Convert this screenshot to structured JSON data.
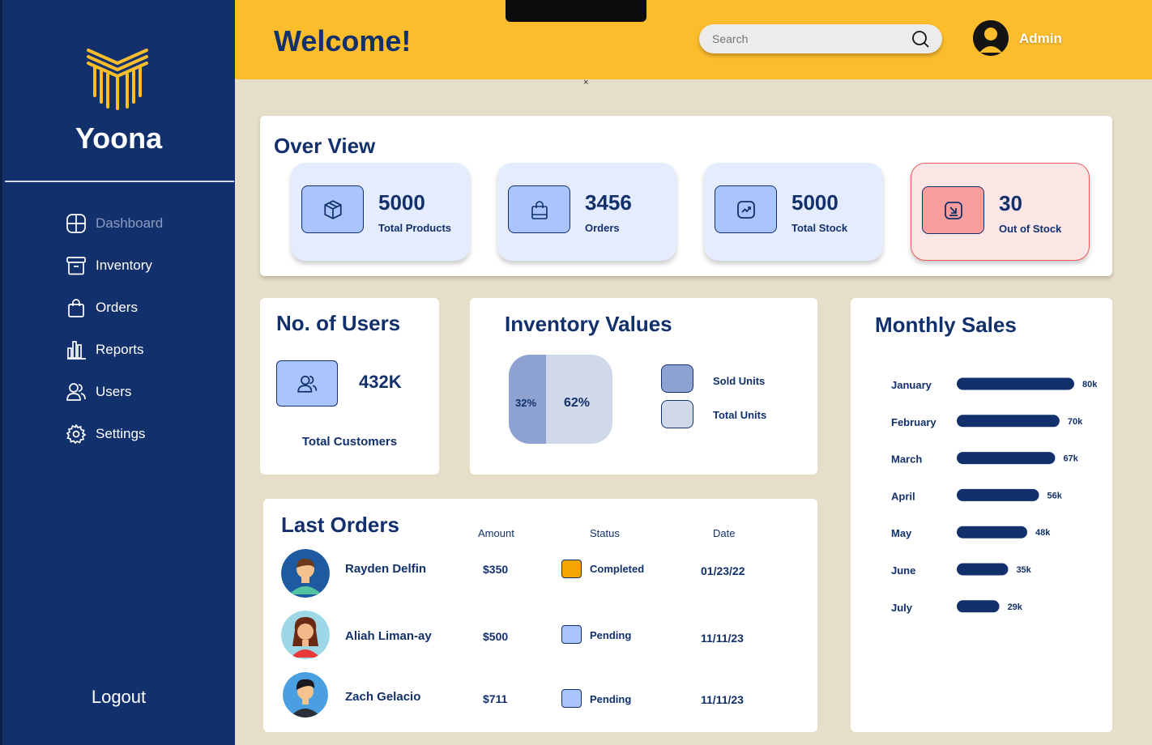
{
  "sidebar": {
    "brand": "Yoona",
    "nav": [
      {
        "label": "Dashboard",
        "icon": "dashboard-icon",
        "active": true
      },
      {
        "label": "Inventory",
        "icon": "archive-icon"
      },
      {
        "label": "Orders",
        "icon": "shopping-bag-icon"
      },
      {
        "label": "Reports",
        "icon": "bar-chart-icon"
      },
      {
        "label": "Users",
        "icon": "users-icon"
      },
      {
        "label": "Settings",
        "icon": "gear-icon"
      }
    ],
    "logout": "Logout"
  },
  "header": {
    "welcome": "Welcome!",
    "search_placeholder": "Search",
    "admin": "Admin",
    "close_mark": "×"
  },
  "overview": {
    "title": "Over View",
    "stats": [
      {
        "value": "5000",
        "label": "Total Products",
        "icon": "box-icon"
      },
      {
        "value": "3456",
        "label": "Orders",
        "icon": "shopping-bag-icon"
      },
      {
        "value": "5000",
        "label": "Total Stock",
        "icon": "trending-up-icon"
      },
      {
        "value": "30",
        "label": "Out of Stock",
        "icon": "download-arrow-icon"
      }
    ]
  },
  "users_card": {
    "title": "No. of Users",
    "value": "432K",
    "label": "Total Customers"
  },
  "inventory": {
    "title": "Inventory Values",
    "sold_pct": "32%",
    "total_pct": "62%",
    "legend": [
      {
        "label": "Sold Units",
        "color": "#8da2d0"
      },
      {
        "label": "Total Units",
        "color": "#d0d9ea"
      }
    ]
  },
  "orders_card": {
    "title": "Last Orders",
    "columns": {
      "amount": "Amount",
      "status": "Status",
      "date": "Date"
    },
    "rows": [
      {
        "name": "Rayden Delfin",
        "amount": "$350",
        "status": "Completed",
        "status_color": "#f5a500",
        "date": "01/23/22"
      },
      {
        "name": "Aliah Liman-ay",
        "amount": "$500",
        "status": "Pending",
        "status_color": "#a9c5fb",
        "date": "11/11/23"
      },
      {
        "name": "Zach Gelacio",
        "amount": "$711",
        "status": "Pending",
        "status_color": "#a9c5fb",
        "date": "11/11/23"
      }
    ]
  },
  "chart_data": {
    "type": "bar",
    "title": "Monthly Sales",
    "categories": [
      "January",
      "February",
      "March",
      "April",
      "May",
      "June",
      "July"
    ],
    "values": [
      80,
      70,
      67,
      56,
      48,
      35,
      29
    ],
    "value_labels": [
      "80k",
      "70k",
      "67k",
      "56k",
      "48k",
      "35k",
      "29k"
    ],
    "orientation": "horizontal",
    "color": "#12306b"
  }
}
